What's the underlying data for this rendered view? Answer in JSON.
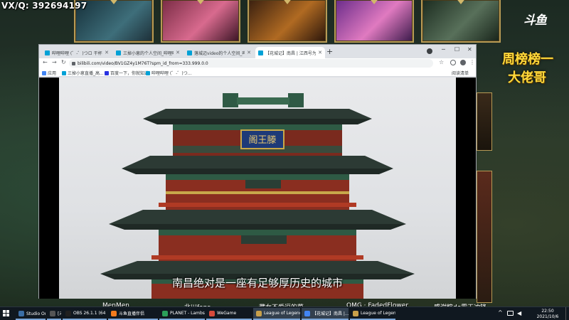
{
  "overlay": {
    "contact": "VX/Q: 392694197",
    "platform_logo": "斗鱼",
    "rank_line_1": "周榜榜一",
    "rank_line_2": "大佬哥",
    "names": [
      "MenMen",
      "北川fans",
      "藏女不爱逗的菜",
      "OMG · FadedFlower",
      "感谢粽de霍王冲锋"
    ]
  },
  "browser": {
    "tabs": [
      {
        "title": "哔哩哔哩 (゜-゜)つロ 干杯~-bi",
        "active": false
      },
      {
        "title": "三掉小崽的个人空间_哔哩哔哩",
        "active": false
      },
      {
        "title": "落城迈video的个人空间_哔哩哔",
        "active": false
      },
      {
        "title": "【花城记】南昌 | 江西号为厂",
        "active": true
      }
    ],
    "new_tab": "+",
    "address": "bilibili.com/video/BV1GZ4y1M76T?spm_id_from=333.999.0.0",
    "bookmarks": {
      "apps": "应用",
      "items": [
        "三掉小崽直播_高...",
        "百度一下，你就知道",
        "哔哩哔哩 (゜-゜)つ..."
      ],
      "reading_list": "阅读清单"
    },
    "video": {
      "subtitle": "南昌绝对是一座有足够厚历史的城市",
      "plaque_text": "阁王滕"
    }
  },
  "taskbar": {
    "items": [
      {
        "label": "Studio One - [未...",
        "icon": "studio-one-icon",
        "color": "#3b6ea5",
        "active": false
      },
      {
        "label": "[未...",
        "icon": "app-icon",
        "color": "#555555",
        "active": false
      },
      {
        "label": "OBS 26.1.1 (64 bi...",
        "icon": "obs-icon",
        "color": "#202020",
        "active": false
      },
      {
        "label": "斗鱼直播伴侣",
        "icon": "douyu-icon",
        "color": "#f27b1d",
        "active": false
      },
      {
        "label": "PLANET - Lambse...",
        "icon": "music-icon",
        "color": "#2b9f5a",
        "active": false
      },
      {
        "label": "WeGame",
        "icon": "wegame-icon",
        "color": "#d64a3b",
        "active": false
      },
      {
        "label": "League of Legends",
        "icon": "lol-icon",
        "color": "#c8a04a",
        "active": true
      },
      {
        "label": "【花城记】南昌 |...",
        "icon": "chrome-icon",
        "color": "#4285f4",
        "active": true
      },
      {
        "label": "League of Legen...",
        "icon": "lol-icon",
        "color": "#c8a04a",
        "active": false
      }
    ],
    "clock_time": "22:50",
    "clock_date": "2021/10/6"
  }
}
